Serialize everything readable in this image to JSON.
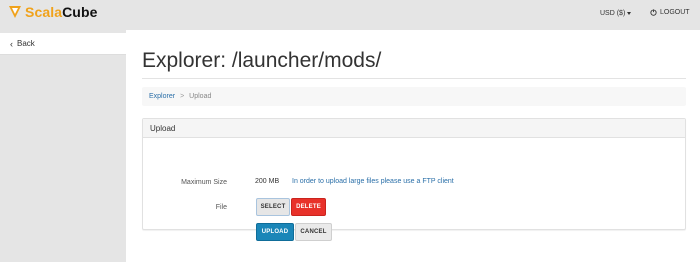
{
  "brand": {
    "part1": "Scala",
    "part2": "Cube",
    "color_accent": "#f0a21b"
  },
  "header": {
    "currency_label": "USD ($)",
    "logout_label": "LOGOUT"
  },
  "sidebar": {
    "back_label": "Back"
  },
  "page": {
    "title": "Explorer: /launcher/mods/"
  },
  "breadcrumb": {
    "items": [
      "Explorer",
      "Upload"
    ],
    "separator": ">"
  },
  "upload_panel": {
    "heading": "Upload",
    "max_size_label": "Maximum Size",
    "max_size_value": "200 MB",
    "ftp_note": "In order to upload large files please use a FTP client",
    "file_label": "File",
    "select_label": "SELECT",
    "delete_label": "DELETE",
    "upload_label": "UPLOAD",
    "cancel_label": "CANCEL"
  },
  "icons": [
    "logo-icon",
    "caret-down-icon",
    "logout-icon",
    "chevron-left-icon"
  ]
}
